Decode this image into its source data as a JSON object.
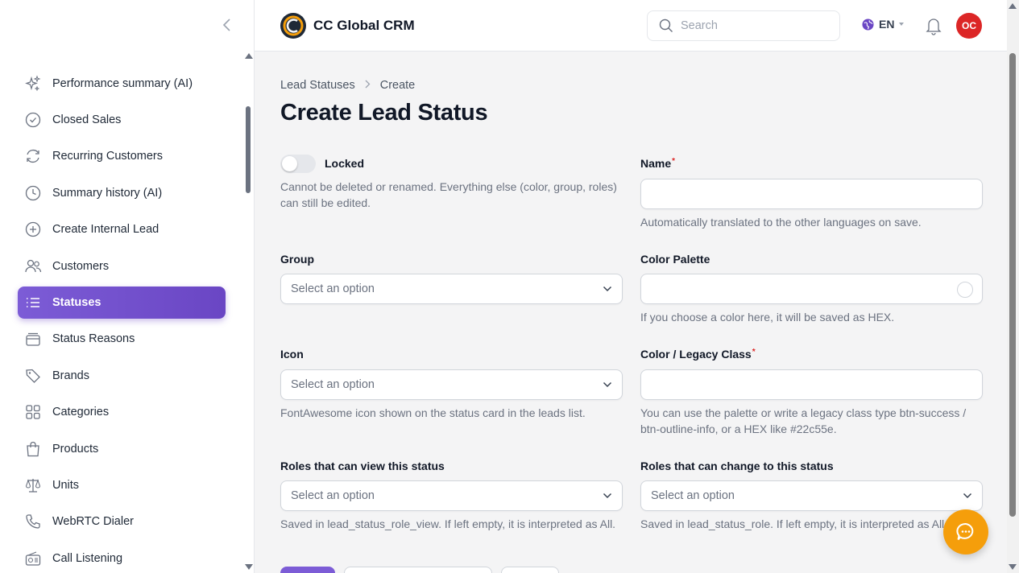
{
  "app": {
    "title": "CC Global CRM"
  },
  "header": {
    "search_placeholder": "Search",
    "language": "EN",
    "avatar_initials": "OC"
  },
  "sidebar": {
    "items": [
      {
        "label": "Performance summary (AI)",
        "icon": "sparkles-icon"
      },
      {
        "label": "Closed Sales",
        "icon": "check-circle-icon"
      },
      {
        "label": "Recurring Customers",
        "icon": "refresh-icon"
      },
      {
        "label": "Summary history (AI)",
        "icon": "clock-icon"
      },
      {
        "label": "Create Internal Lead",
        "icon": "plus-circle-icon"
      },
      {
        "label": "Customers",
        "icon": "users-icon"
      },
      {
        "label": "Statuses",
        "icon": "list-icon",
        "active": true
      },
      {
        "label": "Status Reasons",
        "icon": "tray-icon"
      },
      {
        "label": "Brands",
        "icon": "tag-icon"
      },
      {
        "label": "Categories",
        "icon": "grid-icon"
      },
      {
        "label": "Products",
        "icon": "shopping-bag-icon"
      },
      {
        "label": "Units",
        "icon": "scale-icon"
      },
      {
        "label": "WebRTC Dialer",
        "icon": "phone-icon"
      },
      {
        "label": "Call Listening",
        "icon": "radio-icon"
      }
    ]
  },
  "breadcrumb": {
    "parent": "Lead Statuses",
    "current": "Create"
  },
  "page": {
    "title": "Create Lead Status"
  },
  "form": {
    "locked": {
      "label": "Locked",
      "help": "Cannot be deleted or renamed. Everything else (color, group, roles) can still be edited.",
      "value": false
    },
    "name": {
      "label": "Name",
      "required": "*",
      "value": "",
      "help": "Automatically translated to the other languages on save."
    },
    "group": {
      "label": "Group",
      "placeholder": "Select an option"
    },
    "color_palette": {
      "label": "Color Palette",
      "value": "",
      "help": "If you choose a color here, it will be saved as HEX."
    },
    "icon": {
      "label": "Icon",
      "placeholder": "Select an option",
      "help": "FontAwesome icon shown on the status card in the leads list."
    },
    "legacy_class": {
      "label": "Color / Legacy Class",
      "required": "*",
      "value": "",
      "help": "You can use the palette or write a legacy class type btn-success / btn-outline-info, or a HEX like #22c55e."
    },
    "roles_view": {
      "label": "Roles that can view this status",
      "placeholder": "Select an option",
      "help": "Saved in lead_status_role_view. If left empty, it is interpreted as All."
    },
    "roles_change": {
      "label": "Roles that can change to this status",
      "placeholder": "Select an option",
      "help": "Saved in lead_status_role. If left empty, it is interpreted as All."
    }
  },
  "colors": {
    "accent": "#7c5cd6",
    "avatar": "#dc2626",
    "fab": "#f59e0b"
  }
}
